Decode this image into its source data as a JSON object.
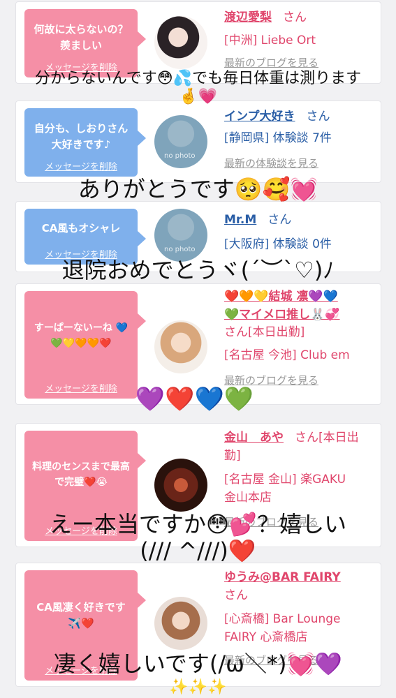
{
  "cards": [
    {
      "message": "何故に太らないの？羨ましい",
      "delete_label": "メッセージを削除",
      "name": "渡辺愛梨",
      "san": "さん",
      "line1": "[中洲] Liebe Ort",
      "line2": "",
      "link": "最新のブログを見る"
    },
    {
      "message": "自分も、しおりさん大好きです♪",
      "delete_label": "メッセージを削除",
      "name": "インプ大好き",
      "san": "さん",
      "line1": "[静岡県] 体験談 7件",
      "line2": "",
      "link": "最新の体験談を見る",
      "nophoto": "no photo"
    },
    {
      "message": "CA風もオシャレ",
      "delete_label": "メッセージを削除",
      "name": "Mr.M",
      "san": "さん",
      "line1": "[大阪府] 体験談 0件",
      "line2": "",
      "link": "",
      "nophoto": "no photo"
    },
    {
      "message": "すーぱーないーね 💙💚💛🧡🧡❤️",
      "delete_label": "メッセージを削除",
      "name": "❤️🧡💛結城 凛💜💙",
      "name2": "💚マイメロ推し🐰💞",
      "san": "さん[本日出勤]",
      "line1": "[名古屋 今池] Club em",
      "line2": "",
      "link": "最新のブログを見る"
    },
    {
      "message": "料理のセンスまで最高で完璧❤️😭",
      "delete_label": "メッセージを削除",
      "name": "金山　あや",
      "san": "さん[本日出勤]",
      "line1": "[名古屋 金山] 楽GAKU",
      "line2": "金山本店",
      "link": "最新のブログを見る"
    },
    {
      "message": "CA風凄く好きです✈️❤️",
      "delete_label": "メッセージを削除",
      "name": "ゆうみ@BAR FAIRY",
      "san": "さん",
      "line1": "[心斎橋] Bar Lounge",
      "line2": "FAIRY 心斎橋店",
      "link": "最新のブログを見る"
    }
  ],
  "overlays": [
    "分からないんです😳💦でも毎日体重は測ります",
    "🤞💗",
    "ありがとうです🥺🥰💓",
    "退院おめでとうヾ(´︶`♡)ﾉ",
    "💜❤️💙💚",
    "えー本当ですか😳💕？嬉しい",
    "(/// ^///)❤️",
    "凄く嬉しいです(/ω＼*)💓💜",
    "✨✨✨"
  ]
}
